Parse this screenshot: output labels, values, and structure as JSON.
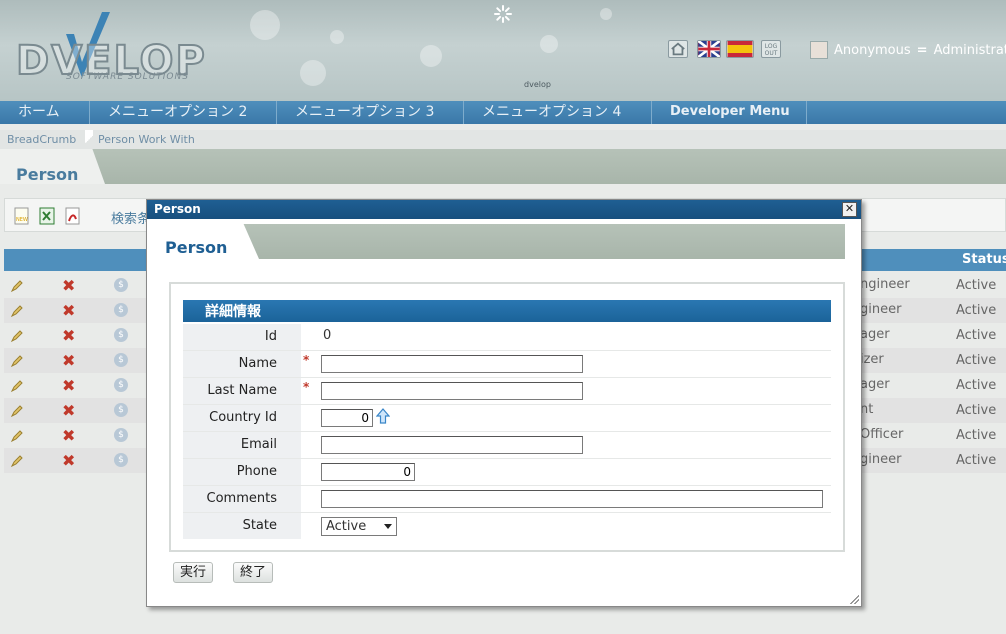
{
  "header": {
    "logo_text": "DVELOP",
    "logo_tagline": "SOFTWARE SOLUTIONS",
    "center_mark": "dvelop",
    "icons": [
      "home-icon",
      "english-flag-icon",
      "spanish-flag-icon",
      "logout-icon"
    ],
    "logout_label": "LOG OUT",
    "user_name": "Anonymous",
    "user_separator": "=",
    "user_role": "Administrator"
  },
  "nav": {
    "items": [
      {
        "label": "ホーム"
      },
      {
        "label": "メニューオプション 2"
      },
      {
        "label": "メニューオプション 3"
      },
      {
        "label": "メニューオプション 4"
      },
      {
        "label": "Developer Menu"
      }
    ]
  },
  "breadcrumb": {
    "items": [
      {
        "label": "BreadCrumb"
      },
      {
        "label": "Person Work With"
      }
    ]
  },
  "page": {
    "title": "Person",
    "search_label": "検索条"
  },
  "grid": {
    "status_header": "Status",
    "rows": [
      {
        "role": "ngineer",
        "status": "Active"
      },
      {
        "role": "gineer",
        "status": "Active"
      },
      {
        "role": "ager",
        "status": "Active"
      },
      {
        "role": "izer",
        "status": "Active"
      },
      {
        "role": "ager",
        "status": "Active"
      },
      {
        "role": "nt",
        "status": "Active"
      },
      {
        "role": "Officer",
        "status": "Active"
      },
      {
        "role": "gineer",
        "status": "Active"
      }
    ],
    "coin_symbol": "$"
  },
  "modal": {
    "window_title": "Person",
    "close_symbol": "✕",
    "tab_title": "Person",
    "section_title": "詳細情報",
    "fields": {
      "id": {
        "label": "Id",
        "value": "0"
      },
      "name": {
        "label": "Name",
        "value": "",
        "required": "*"
      },
      "last_name": {
        "label": "Last Name",
        "value": "",
        "required": "*"
      },
      "country_id": {
        "label": "Country Id",
        "value": "0"
      },
      "email": {
        "label": "Email",
        "value": ""
      },
      "phone": {
        "label": "Phone",
        "value": "0"
      },
      "comments": {
        "label": "Comments",
        "value": ""
      },
      "state": {
        "label": "State",
        "value": "Active"
      }
    },
    "buttons": {
      "execute": "実行",
      "close": "終了"
    }
  },
  "colors": {
    "nav_blue": "#3a78a8",
    "modal_title_blue": "#1f5f93",
    "required_red": "#c0392b",
    "delete_red": "#c0392b"
  }
}
